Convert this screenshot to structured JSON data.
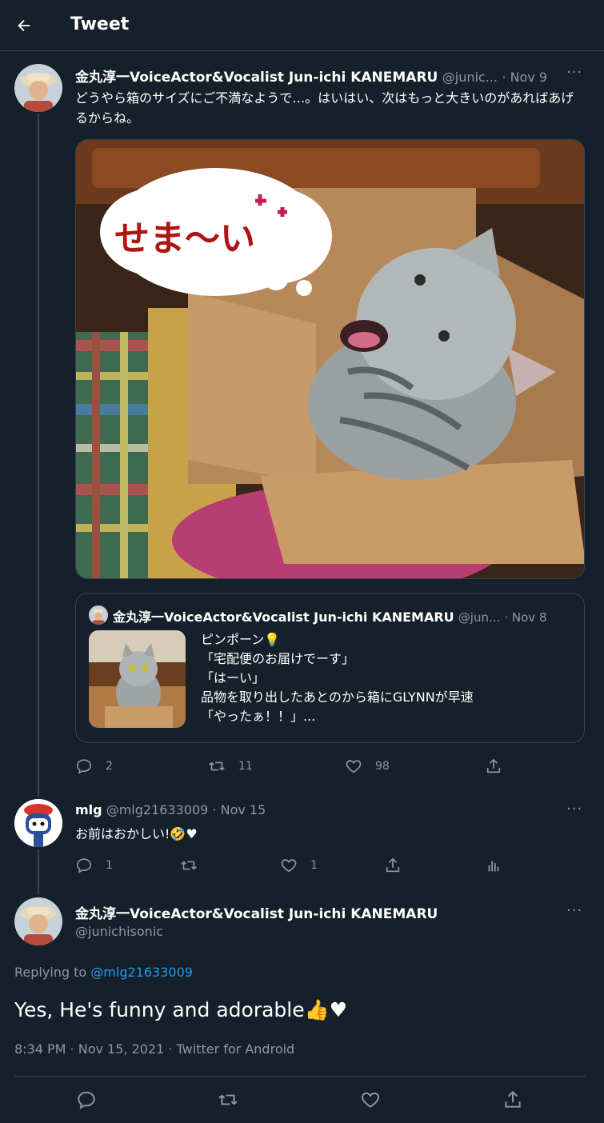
{
  "header": {
    "title": "Tweet"
  },
  "tweet1": {
    "name": "金丸淳一VoiceActor&Vocalist Jun-ichi KANEMARU",
    "handle": "@junic...",
    "date": "· Nov 9",
    "text": "どうやら箱のサイズにご不満なようで…。はいはい、次はもっと大きいのがあればあげるからね。",
    "image": {
      "bubble_text": "せま〜い"
    },
    "quote": {
      "name": "金丸淳一VoiceActor&Vocalist Jun-ichi KANEMARU",
      "handle": "@jun...",
      "date": "· Nov 8",
      "lines": [
        "ピンポーン💡",
        "「宅配便のお届けでーす」",
        "「はーい」",
        "品物を取り出したあとのから箱にGLYNNが早速",
        "「やったぁ！！」..."
      ]
    },
    "actions": {
      "replies": "2",
      "retweets": "11",
      "likes": "98"
    }
  },
  "tweet2": {
    "name": "mlg",
    "handle": "@mlg21633009",
    "date": "· Nov 15",
    "text": "お前はおかしい!🤣♥",
    "actions": {
      "replies": "1",
      "likes": "1"
    }
  },
  "main_tweet": {
    "name": "金丸淳一VoiceActor&Vocalist Jun-ichi KANEMARU",
    "handle": "@junichisonic",
    "replying_prefix": "Replying to",
    "replying_to": "@mlg21633009",
    "text": "Yes, He's funny and adorable👍♥",
    "meta": "8:34 PM · Nov 15, 2021 · Twitter for Android"
  },
  "colors": {
    "background": "#15202b",
    "accent": "#1d9bf0",
    "border": "#38444d",
    "muted": "#8b98a5"
  }
}
